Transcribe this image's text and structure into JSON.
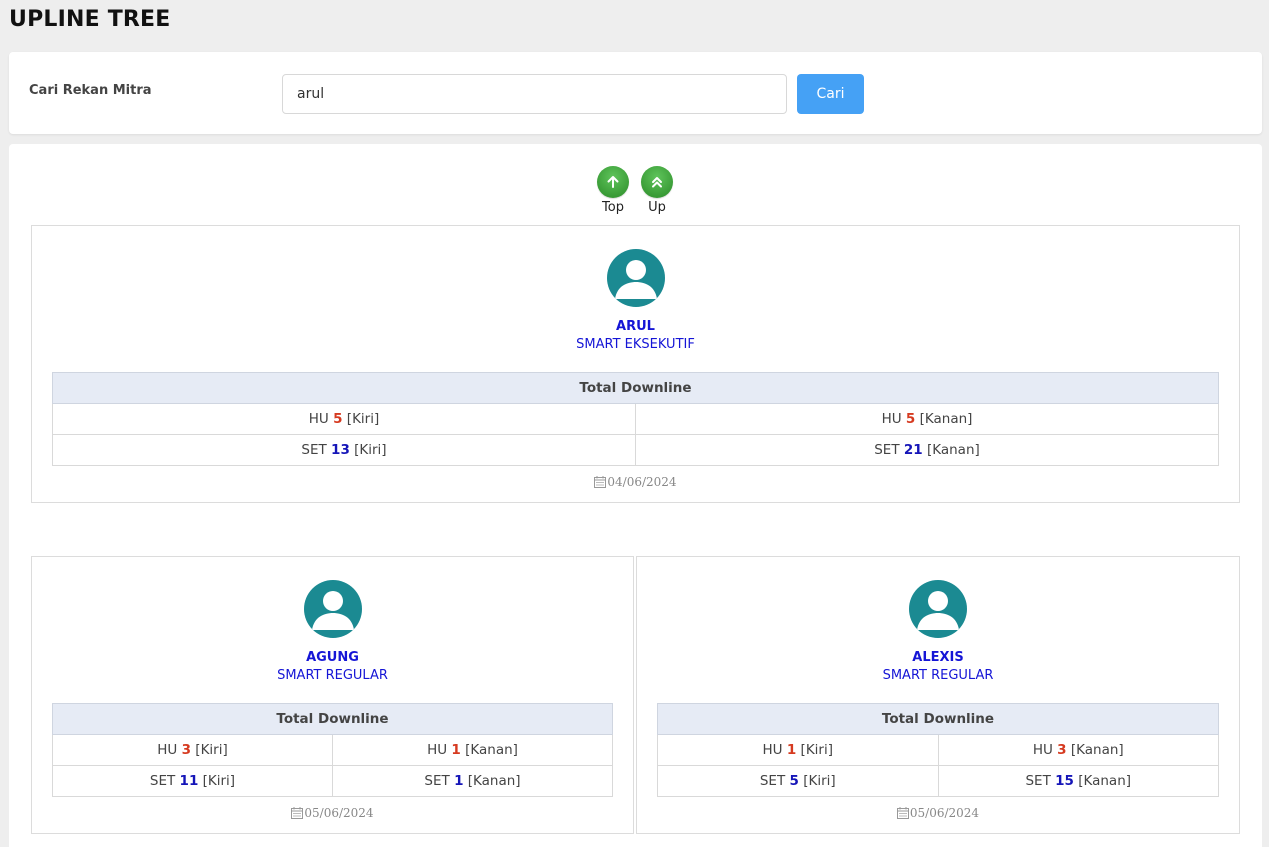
{
  "page_title": "UPLINE TREE",
  "search": {
    "label": "Cari Rekan Mitra",
    "value": "arul",
    "button_label": "Cari"
  },
  "nav": {
    "top_label": "Top",
    "up_label": "Up"
  },
  "table_header": "Total Downline",
  "labels": {
    "hu": "HU",
    "set": "SET",
    "left": "[Kiri]",
    "right": "[Kanan]"
  },
  "nodes": [
    {
      "name": "ARUL",
      "rank": "SMART EKSEKUTIF",
      "hu_left": "5",
      "hu_right": "5",
      "set_left": "13",
      "set_right": "21",
      "date": "04/06/2024"
    },
    {
      "name": "AGUNG",
      "rank": "SMART REGULAR",
      "hu_left": "3",
      "hu_right": "1",
      "set_left": "11",
      "set_right": "1",
      "date": "05/06/2024"
    },
    {
      "name": "ALEXIS",
      "rank": "SMART REGULAR",
      "hu_left": "1",
      "hu_right": "3",
      "set_left": "5",
      "set_right": "15",
      "date": "05/06/2024"
    }
  ],
  "colors": {
    "accent_button": "#45a1f5",
    "nav_green": "#3a9c37",
    "avatar_teal": "#1b8a92",
    "name_blue": "#1515d6",
    "hu_red": "#d63a20",
    "set_blue": "#1515b8",
    "table_header_bg": "#e6ebf5"
  }
}
